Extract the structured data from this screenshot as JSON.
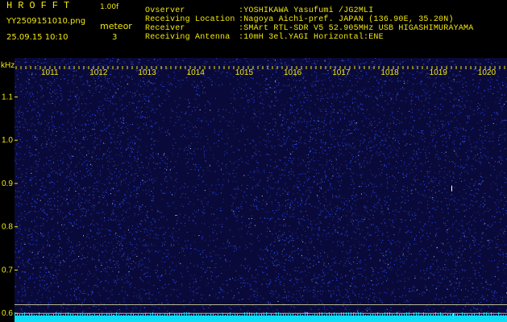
{
  "header": {
    "app_name": "HROFFT",
    "version": "1.00f",
    "filename": "YY2509151010.png",
    "datetime": "25.09.15 10:10",
    "meteor_label": "meteor",
    "meteor_count": "3",
    "observer_label": "Ovserver",
    "observer_value": ":YOSHIKAWA Yasufumi /JG2MLI",
    "location_label": "Receiving Location",
    "location_value": ":Nagoya Aichi-pref. JAPAN (136.90E, 35.20N)",
    "receiver_label": "Receiver",
    "receiver_value": ":SMArt RTL-SDR V5 52.905MHz USB HIGASHIMURAYAMA",
    "antenna_label": "Receiving Antenna",
    "antenna_value": ":10mH 3el.YAGI Horizontal:ENE"
  },
  "chart_data": {
    "type": "heatmap",
    "title": "",
    "ylabel": "kHz",
    "xlabel": "",
    "x_ticks": [
      "1011",
      "1012",
      "1013",
      "1014",
      "1015",
      "1016",
      "1017",
      "1018",
      "1019",
      "1020"
    ],
    "y_ticks": [
      "1.1",
      "1.0",
      "0.9",
      "0.8",
      "0.7",
      "0.6"
    ],
    "ylim": [
      0.58,
      1.19
    ],
    "reference_lines_khz": [
      0.62,
      0.6
    ],
    "colors": {
      "noise_base": "#0a0a3a",
      "speckle": "#2a4cff",
      "baseline": "#10e8ff",
      "text": "#f2e70f",
      "markers": "#ffffff",
      "reference_line": "#d6d6a0"
    }
  }
}
